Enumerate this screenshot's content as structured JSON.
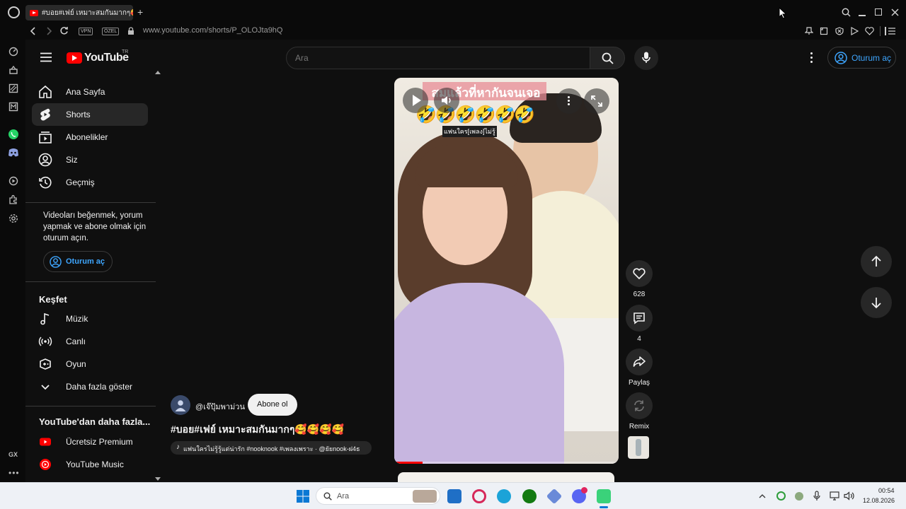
{
  "browser": {
    "tab_title": "#บอย#เฟย์ เหมาะสมกันมากๆ🥰🥰",
    "url": "www.youtube.com/shorts/P_OLOJta9hQ",
    "vpn_label": "VPN",
    "private_label": "ÖZEL",
    "gx_label": "GX"
  },
  "youtube": {
    "logo_text": "YouTube",
    "region": "TR",
    "search_placeholder": "Ara",
    "signin_label": "Oturum aç",
    "nav": [
      {
        "label": "Ana Sayfa"
      },
      {
        "label": "Shorts"
      },
      {
        "label": "Abonelikler"
      },
      {
        "label": "Siz"
      },
      {
        "label": "Geçmiş"
      }
    ],
    "signin_prompt": "Videoları beğenmek, yorum yapmak ve abone olmak için oturum açın.",
    "signin_button": "Oturum aç",
    "explore_title": "Keşfet",
    "explore": [
      {
        "label": "Müzik"
      },
      {
        "label": "Canlı"
      },
      {
        "label": "Oyun"
      },
      {
        "label": "Daha fazla göster"
      }
    ],
    "more_title": "YouTube'dan daha fazla...",
    "more": [
      {
        "label": "Ücretsiz Premium"
      },
      {
        "label": "YouTube Music"
      }
    ]
  },
  "short": {
    "channel": "@เจ๊ปุ้มพาม่วน",
    "subscribe_label": "Abone ol",
    "title": "#บอย#เฟย์ เหมาะสมกันมากๆ🥰🥰🥰🥰",
    "music": "แฟนใครไม่รู้รู้แต่น่ารัก #nooknook #เพลงเพราะ · @ยัยnook-ฝ4ธ",
    "overlay_title": "สมแล้วที่หากันจนเจอ",
    "overlay_emojis": "🤣🤣🤣🤣🤣🤣",
    "overlay_sub": "แฟนใคร[เพลง]ไม่รู้",
    "likes": "628",
    "comments": "4",
    "share_label": "Paylaş",
    "remix_label": "Remix"
  },
  "taskbar": {
    "search_label": "Ara",
    "time": "00:54",
    "date": "12.08.2026"
  }
}
